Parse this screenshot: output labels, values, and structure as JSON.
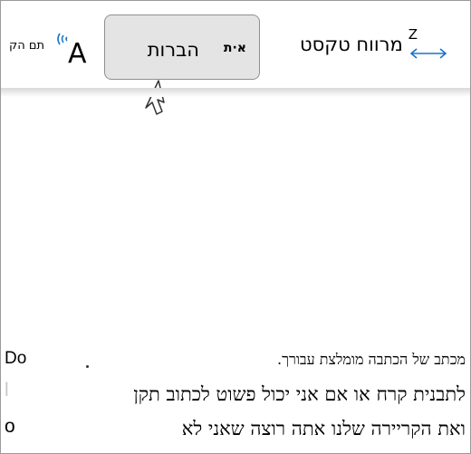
{
  "toolbar": {
    "text_spacing": {
      "label": "מרווח טקסט",
      "icon_text": "AZ",
      "icon": "text-spacing-icon"
    },
    "syllables": {
      "label": "הברות",
      "icon_text": "א·ת",
      "icon": "syllables-icon"
    },
    "read_aloud": {
      "label": "תם הק",
      "icon_text": "A",
      "icon": "read-aloud-icon"
    }
  },
  "document": {
    "lines": [
      "מכתב של הכתבה מומלצת עבורך.",
      "לתבנית קרח או אם אני יכול פשוט לכתוב תקן",
      "ואת הקריירה שלנו אתה רוצה שאני לא"
    ],
    "left_fragments": [
      "Do",
      "l",
      "o"
    ]
  },
  "colors": {
    "hover_background": "#e4e4e4",
    "hover_border": "#8f8f8f",
    "spacing_arrow": "#1a73c8",
    "read_waves": "#1a73c8"
  }
}
